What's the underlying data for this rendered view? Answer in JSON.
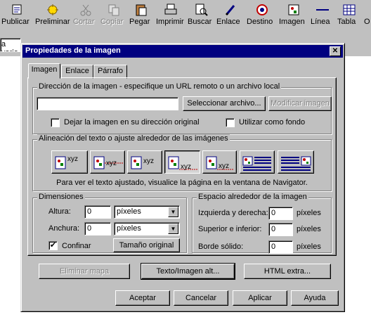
{
  "toolbar": {
    "items": [
      {
        "label": "Publicar",
        "icon": "publish-icon",
        "enabled": true
      },
      {
        "label": "Preliminar",
        "icon": "preview-icon",
        "enabled": true
      },
      {
        "label": "Cortar",
        "icon": "cut-icon",
        "enabled": false
      },
      {
        "label": "Copiar",
        "icon": "copy-icon",
        "enabled": false
      },
      {
        "label": "Pegar",
        "icon": "paste-icon",
        "enabled": true
      },
      {
        "label": "Imprimir",
        "icon": "print-icon",
        "enabled": true
      },
      {
        "label": "Buscar",
        "icon": "find-icon",
        "enabled": true
      },
      {
        "label": "Enlace",
        "icon": "link-icon",
        "enabled": true
      },
      {
        "label": "Destino",
        "icon": "target-icon",
        "enabled": true
      },
      {
        "label": "Imagen",
        "icon": "image-icon",
        "enabled": true
      },
      {
        "label": "Línea",
        "icon": "line-icon",
        "enabled": true
      },
      {
        "label": "Tabla",
        "icon": "table-icon",
        "enabled": true
      },
      {
        "label": "O",
        "icon": "",
        "enabled": true
      }
    ],
    "style_field_value": "a varia"
  },
  "dialog": {
    "title": "Propiedades de la imagen",
    "close_glyph": "✕",
    "tabs": [
      "Imagen",
      "Enlace",
      "Párrafo"
    ],
    "image_location": {
      "title": "Dirección de la imagen - especifique un URL remoto o un archivo local",
      "url_value": "",
      "select_file_button": "Seleccionar archivo...",
      "edit_image_button": "Modificar imagen",
      "keep_original_label": "Dejar la imagen en su dirección original",
      "keep_original_checked": false,
      "use_as_background_label": "Utilizar como fondo",
      "use_as_background_checked": false
    },
    "alignment": {
      "title": "Alineación del texto o ajuste alrededor de las imágenes",
      "option_text": "xyz",
      "selected_index": 3,
      "note": "Para ver el texto ajustado, visualice la página en la ventana de Navigator."
    },
    "dimensions": {
      "title": "Dimensiones",
      "height_label": "Altura:",
      "height_value": "0",
      "height_unit": "píxeles",
      "width_label": "Anchura:",
      "width_value": "0",
      "width_unit": "píxeles",
      "constrain_label": "Confinar",
      "constrain_checked": true,
      "original_size_button": "Tamaño original"
    },
    "spacing": {
      "title": "Espacio alrededor de la imagen",
      "left_right_label": "Izquierda y derecha:",
      "left_right_value": "0",
      "top_bottom_label": "Superior e inferior:",
      "top_bottom_value": "0",
      "border_label": "Borde sólido:",
      "border_value": "0",
      "unit": "píxeles"
    },
    "extra_buttons": {
      "remove_map": "Eliminar mapa",
      "alt_text": "Texto/Imagen alt...",
      "extra_html": "HTML extra..."
    },
    "footer": {
      "ok": "Aceptar",
      "cancel": "Cancelar",
      "apply": "Aplicar",
      "help": "Ayuda"
    }
  },
  "colors": {
    "face": "#c0c0c0",
    "title_bar": "#000080",
    "disabled_text": "#808080"
  }
}
